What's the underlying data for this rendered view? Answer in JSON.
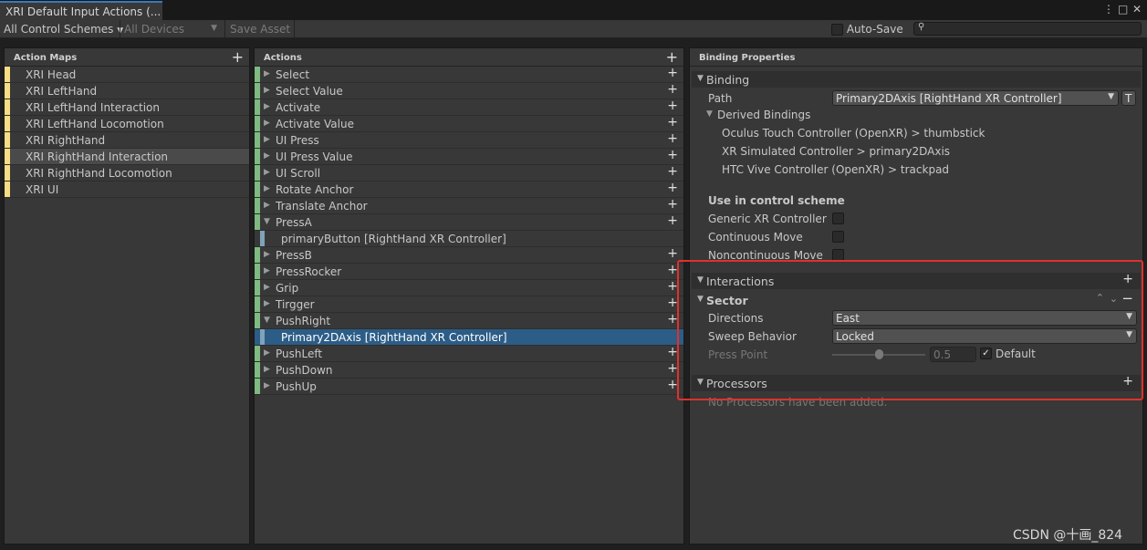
{
  "window": {
    "tab_title": "XRI Default Input Actions (...",
    "menu_icon": "⋮",
    "maximize_icon": "□",
    "close_icon": "✕"
  },
  "toolbar": {
    "control_schemes": "All Control Schemes",
    "devices": "All Devices",
    "save_asset": "Save Asset",
    "auto_save": "Auto-Save",
    "search_icon": "🔍",
    "search_value": ""
  },
  "action_maps": {
    "title": "Action Maps",
    "items": [
      "XRI Head",
      "XRI LeftHand",
      "XRI LeftHand Interaction",
      "XRI LeftHand Locomotion",
      "XRI RightHand",
      "XRI RightHand Interaction",
      "XRI RightHand Locomotion",
      "XRI UI"
    ],
    "selected": "XRI RightHand Interaction"
  },
  "actions": {
    "title": "Actions",
    "items": [
      "Select",
      "Select Value",
      "Activate",
      "Activate Value",
      "UI Press",
      "UI Press Value",
      "UI Scroll",
      "Rotate Anchor",
      "Translate Anchor",
      "PressA",
      "primaryButton [RightHand XR Controller]",
      "PressB",
      "PressRocker",
      "Grip",
      "Tirgger",
      "PushRight",
      "Primary2DAxis [RightHand XR Controller]",
      "PushLeft",
      "PushDown",
      "PushUp"
    ]
  },
  "binding_properties": {
    "title": "Binding Properties",
    "binding_section": "Binding",
    "path_label": "Path",
    "path_value": "Primary2DAxis [RightHand XR Controller]",
    "path_t": "T",
    "derived_bindings": "Derived Bindings",
    "derived": [
      "Oculus Touch Controller (OpenXR) > thumbstick",
      "XR Simulated Controller > primary2DAxis",
      "HTC Vive Controller (OpenXR) > trackpad"
    ],
    "use_in_scheme": "Use in control scheme",
    "schemes": [
      "Generic XR Controller",
      "Continuous Move",
      "Noncontinuous Move"
    ],
    "interactions": "Interactions",
    "sector": "Sector",
    "directions_label": "Directions",
    "directions_value": "East",
    "sweep_label": "Sweep Behavior",
    "sweep_value": "Locked",
    "press_point_label": "Press Point",
    "press_point_value": "0.5",
    "press_point_slider": 0.5,
    "default_label": "Default",
    "processors": "Processors",
    "no_processors": "No Processors have been added."
  },
  "watermark": "CSDN @十画_824"
}
